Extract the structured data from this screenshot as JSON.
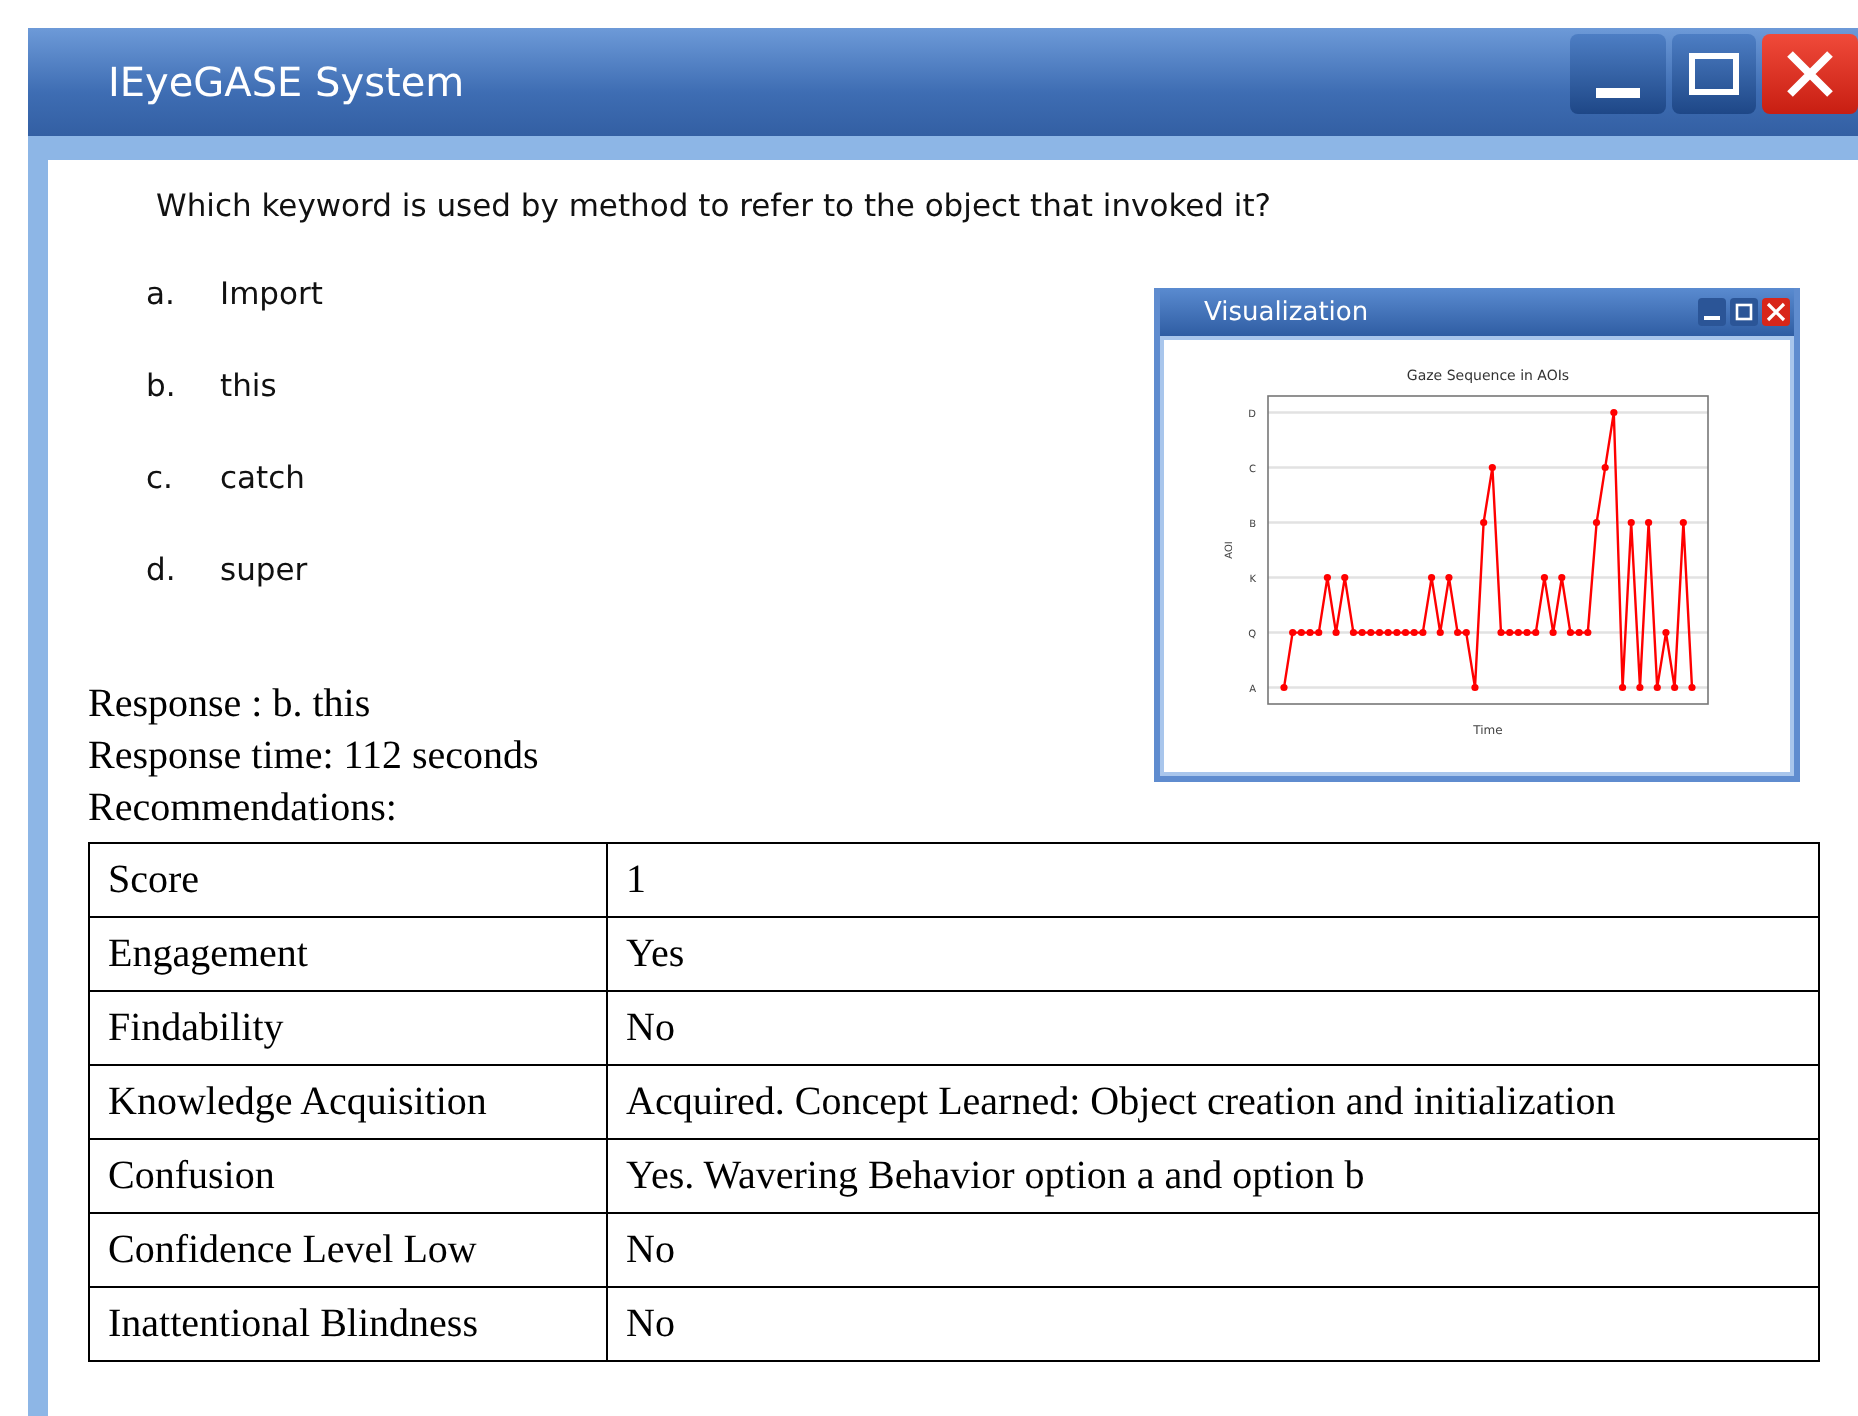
{
  "window": {
    "title": "IEyeGASE System"
  },
  "question": {
    "text": "Which keyword is used by method to refer to the object that invoked it?",
    "options": [
      {
        "letter": "a.",
        "text": "Import"
      },
      {
        "letter": "b.",
        "text": "this"
      },
      {
        "letter": "c.",
        "text": "catch"
      },
      {
        "letter": "d.",
        "text": "super"
      }
    ]
  },
  "response": [
    "Response : b. this",
    "Response time: 112 seconds",
    "Recommendations:"
  ],
  "visualization": {
    "title": "Visualization",
    "chart": {
      "title": "Gaze Sequence in AOIs",
      "xlabel": "Time",
      "ylabel": "AOI",
      "y_labels": [
        "D",
        "C",
        "B",
        "K",
        "Q",
        "A"
      ]
    }
  },
  "table": {
    "rows": [
      [
        "Score",
        "1"
      ],
      [
        "Engagement",
        "Yes"
      ],
      [
        "Findability",
        "No"
      ],
      [
        "Knowledge Acquisition",
        "Acquired. Concept Learned: Object creation and initialization"
      ],
      [
        "Confusion",
        "Yes. Wavering Behavior option a and option b"
      ],
      [
        "Confidence Level Low",
        "No"
      ],
      [
        "Inattentional Blindness",
        "No"
      ]
    ]
  }
}
